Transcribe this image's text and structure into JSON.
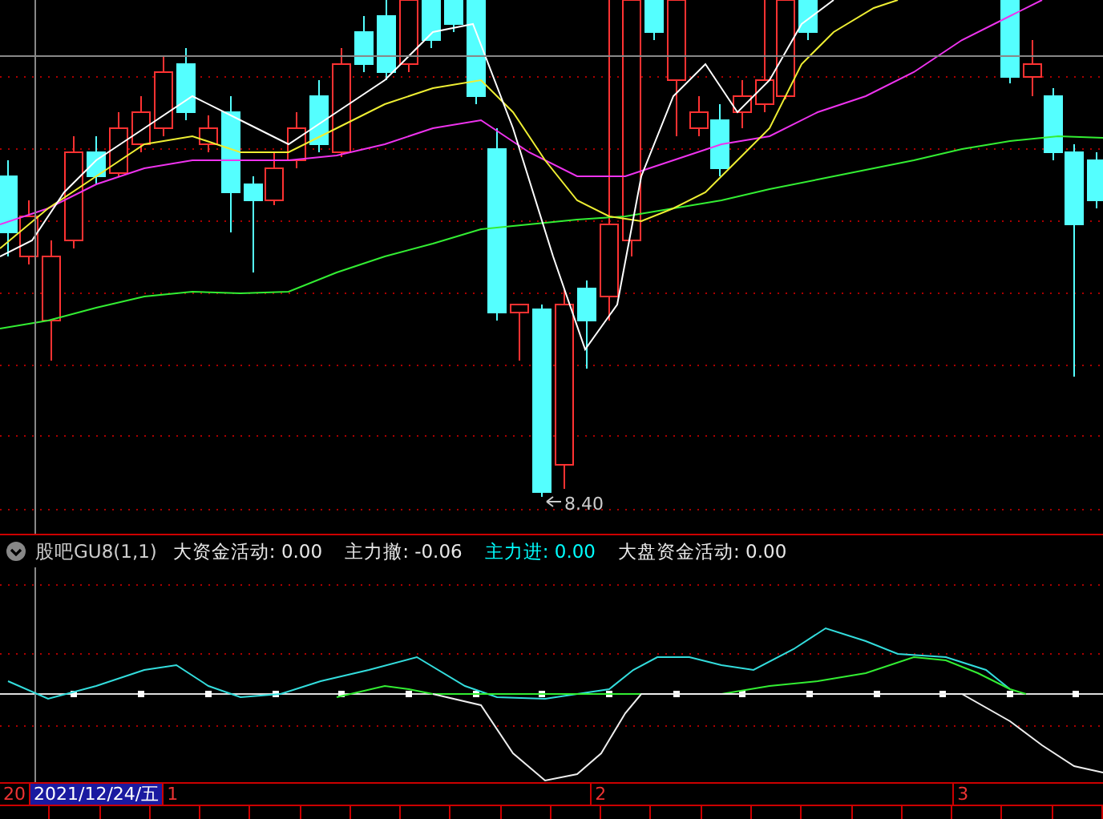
{
  "main_chart": {
    "low_label": "8.40"
  },
  "indicator": {
    "name": "股吧GU8(1,1)",
    "readings": [
      {
        "label": "大资金活动:",
        "value": "0.00",
        "color": "#e8e8e8"
      },
      {
        "label": "主力撤:",
        "value": "-0.06",
        "color": "#e8e8e8"
      },
      {
        "label": "主力进:",
        "value": "0.00",
        "color": "#00ffff"
      },
      {
        "label": "大盘资金活动:",
        "value": "0.00",
        "color": "#e8e8e8"
      }
    ]
  },
  "time_axis": {
    "cut_label": "20",
    "date": "2021/12/24/五",
    "months": [
      {
        "label": "1"
      },
      {
        "label": "2"
      },
      {
        "label": "3"
      }
    ]
  }
}
